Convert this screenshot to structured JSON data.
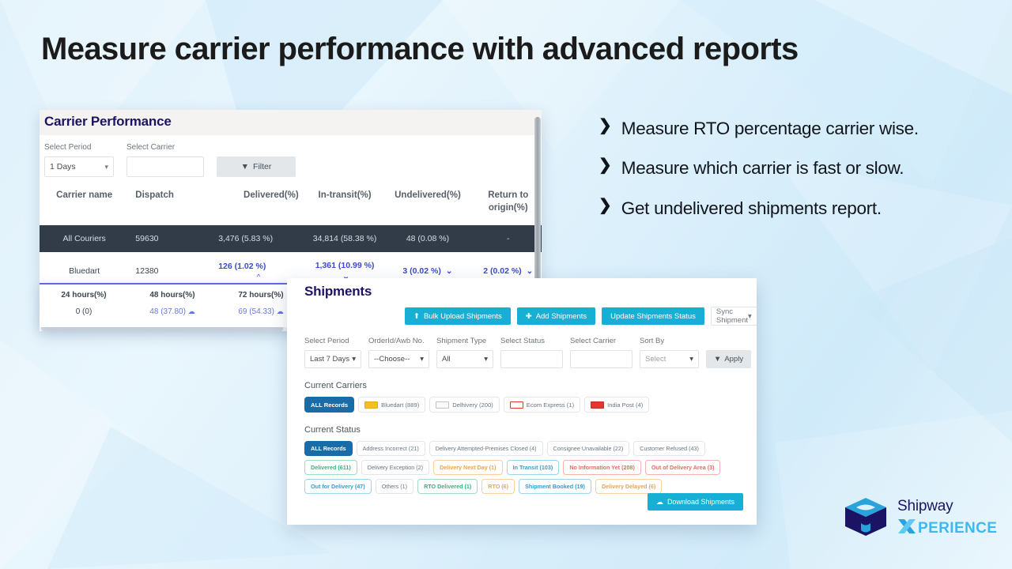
{
  "headline": "Measure carrier performance with advanced reports",
  "carrier_performance": {
    "title": "Carrier Performance",
    "filters": {
      "period_label": "Select Period",
      "period_value": "1 Days",
      "carrier_label": "Select Carrier",
      "carrier_value": "",
      "filter_button": "Filter"
    },
    "columns": [
      "Carrier name",
      "Dispatch",
      "Delivered(%)",
      "In-transit(%)",
      "Undelivered(%)",
      "Return to origin(%)"
    ],
    "rows": [
      {
        "carrier": "All Couriers",
        "dispatch": "59630",
        "delivered": "3,476 (5.83 %)",
        "in_transit": "34,814 (58.38 %)",
        "undelivered": "48 (0.08 %)",
        "rto": "-"
      },
      {
        "carrier": "Bluedart",
        "dispatch": "12380",
        "delivered": "126 (1.02 %)",
        "in_transit": "1,361 (10.99 %)",
        "undelivered": "3 (0.02 %)",
        "rto": "2 (0.02 %)"
      }
    ],
    "hours_table": {
      "columns": [
        "24 hours(%)",
        "48 hours(%)",
        "72 hours(%)"
      ],
      "values": [
        "0 (0)",
        "48 (37.80)",
        "69 (54.33)"
      ]
    }
  },
  "bullets": [
    "Measure RTO percentage carrier wise.",
    "Measure which carrier is fast or slow.",
    "Get undelivered shipments report."
  ],
  "shipments": {
    "title": "Shipments",
    "actions": {
      "bulk_upload": "Bulk Upload Shipments",
      "add": "Add Shipments",
      "update_status": "Update Shipments Status",
      "sync": "Sync Shipment"
    },
    "filters": {
      "period_label": "Select Period",
      "period_value": "Last 7 Days",
      "order_label": "OrderId/Awb No.",
      "order_value": "--Choose--",
      "type_label": "Shipment Type",
      "type_value": "All",
      "status_label": "Select Status",
      "status_value": "",
      "carrier_label": "Select Carrier",
      "carrier_value": "",
      "sort_label": "Sort By",
      "sort_value": "Select",
      "apply": "Apply"
    },
    "current_carriers_label": "Current Carriers",
    "current_carriers": [
      {
        "label": "ALL Records",
        "active": true,
        "swatch": ""
      },
      {
        "label": "Bluedart (889)",
        "active": false,
        "swatch": "#f4c01f"
      },
      {
        "label": "Delhivery (200)",
        "active": false,
        "swatch": "#f2f2f2"
      },
      {
        "label": "Ecom Express (1)",
        "active": false,
        "swatch": "#ffffff"
      },
      {
        "label": "India Post (4)",
        "active": false,
        "swatch": "#e4372e"
      }
    ],
    "current_status_label": "Current Status",
    "current_status": [
      {
        "label": "ALL Records",
        "active": true,
        "color": "#ffffff",
        "border": "#1a6ca8"
      },
      {
        "label": "Address Incorrect (21)",
        "active": false,
        "color": "#6a7480",
        "border": "#e2e6ea"
      },
      {
        "label": "Delivery Attempted-Premises Closed (4)",
        "active": false,
        "color": "#6a7480",
        "border": "#e2e6ea"
      },
      {
        "label": "Consignee Unavailable (22)",
        "active": false,
        "color": "#6a7480",
        "border": "#e2e6ea"
      },
      {
        "label": "Customer Refused (43)",
        "active": false,
        "color": "#6a7480",
        "border": "#e2e6ea"
      },
      {
        "label": "Delivered (611)",
        "active": false,
        "color": "#35b37e",
        "border": "#9fdcc3"
      },
      {
        "label": "Delivery Exception (2)",
        "active": false,
        "color": "#6a7480",
        "border": "#e2e6ea"
      },
      {
        "label": "Delivery Next Day (1)",
        "active": false,
        "color": "#f0a44a",
        "border": "#f6cfa3"
      },
      {
        "label": "In Transit (103)",
        "active": false,
        "color": "#2e9fd4",
        "border": "#9ed4ea"
      },
      {
        "label": "No Information Yet (208)",
        "active": false,
        "color": "#ec6a5e",
        "border": "#f3b2ab"
      },
      {
        "label": "Out of Delivery Area (3)",
        "active": false,
        "color": "#ec6a5e",
        "border": "#f3b2ab"
      },
      {
        "label": "Out for Delivery (47)",
        "active": false,
        "color": "#2e9fd4",
        "border": "#9ed4ea"
      },
      {
        "label": "Others (1)",
        "active": false,
        "color": "#6a7480",
        "border": "#e2e6ea"
      },
      {
        "label": "RTO Delivered (1)",
        "active": false,
        "color": "#35b37e",
        "border": "#9fdcc3"
      },
      {
        "label": "RTO (6)",
        "active": false,
        "color": "#f0a44a",
        "border": "#f6cfa3"
      },
      {
        "label": "Shipment Booked (19)",
        "active": false,
        "color": "#2e9fd4",
        "border": "#9ed4ea"
      },
      {
        "label": "Delivery Delayed (6)",
        "active": false,
        "color": "#f0a44a",
        "border": "#f6cfa3"
      }
    ],
    "download_button": "Download Shipments"
  },
  "logo": {
    "name": "Shipway",
    "tagline": "PERIENCE"
  },
  "colors": {
    "accent_cyan": "#17b0d4",
    "brand_navy": "#1b1464",
    "brand_blue": "#3fb8ef",
    "link_blue": "#3b4ad0",
    "dark_row": "#323c49"
  }
}
